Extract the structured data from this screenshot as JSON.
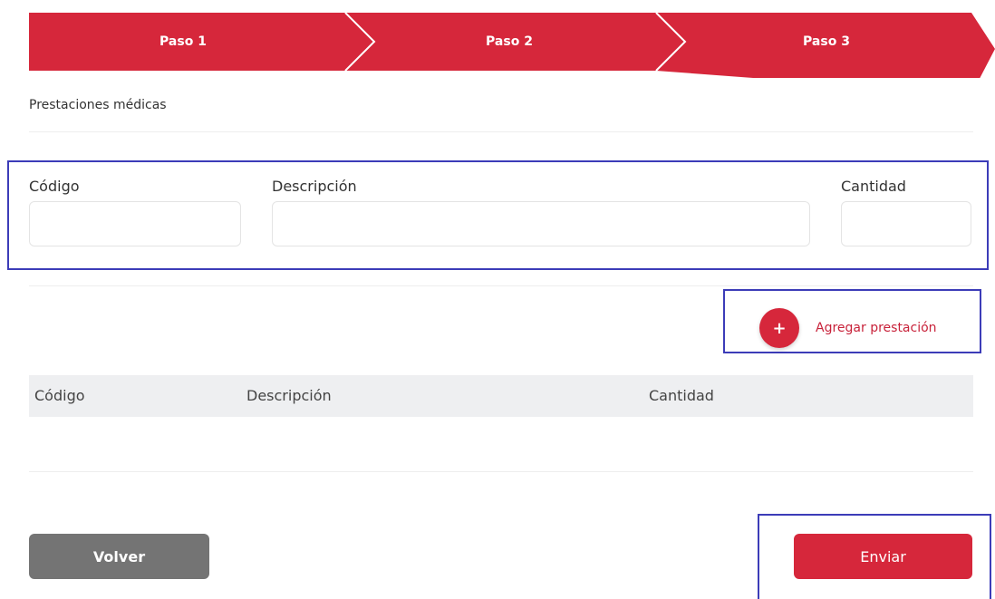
{
  "stepper": {
    "steps": [
      {
        "label": "Paso 1"
      },
      {
        "label": "Paso 2"
      },
      {
        "label": "Paso 3"
      }
    ],
    "color": "#d6273b"
  },
  "section": {
    "title": "Prestaciones médicas"
  },
  "form": {
    "codigo_label": "Código",
    "codigo_value": "",
    "descripcion_label": "Descripción",
    "descripcion_value": "",
    "cantidad_label": "Cantidad",
    "cantidad_value": ""
  },
  "add_button": {
    "icon": "plus-icon",
    "label": "Agregar prestación"
  },
  "table": {
    "columns": [
      "Código",
      "Descripción",
      "Cantidad"
    ],
    "rows": []
  },
  "actions": {
    "back_label": "Volver",
    "submit_label": "Enviar"
  },
  "colors": {
    "accent": "#d6273b",
    "back_button": "#747474",
    "annotation_border": "#3c3cb8"
  }
}
